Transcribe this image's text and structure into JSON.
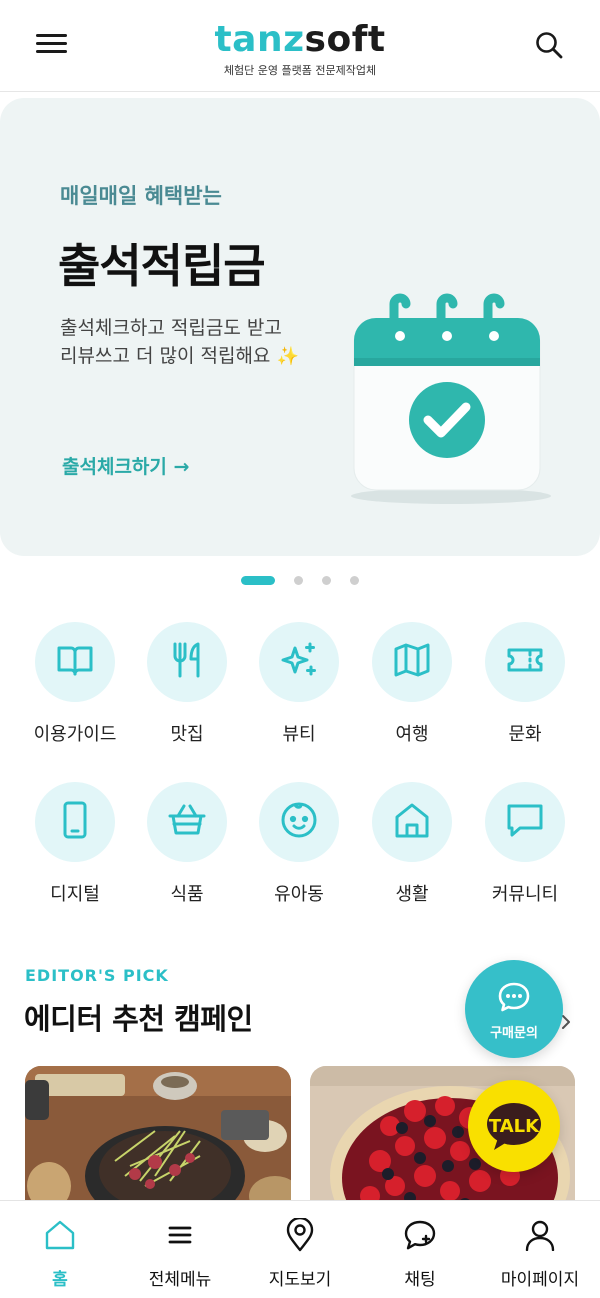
{
  "header": {
    "logo_part1": "tanz",
    "logo_part2": "soft",
    "tagline": "체험단 운영 플랫폼 전문제작업체"
  },
  "banner": {
    "eyebrow": "매일매일 혜택받는",
    "title": "출석적립금",
    "desc_line1": "출석체크하고 적립금도 받고",
    "desc_line2": "리뷰쓰고  더 많이 적립해요",
    "sparkle": "✨",
    "cta": "출석체크하기 →"
  },
  "carousel": {
    "count": 4,
    "active": 1
  },
  "categories": [
    {
      "label": "이용가이드",
      "icon": "book-icon"
    },
    {
      "label": "맛집",
      "icon": "fork-knife-icon"
    },
    {
      "label": "뷰티",
      "icon": "sparkle-icon"
    },
    {
      "label": "여행",
      "icon": "map-icon"
    },
    {
      "label": "문화",
      "icon": "ticket-icon"
    },
    {
      "label": "디지털",
      "icon": "smartphone-icon"
    },
    {
      "label": "식품",
      "icon": "basket-icon"
    },
    {
      "label": "유아동",
      "icon": "baby-face-icon"
    },
    {
      "label": "생활",
      "icon": "home-icon"
    },
    {
      "label": "커뮤니티",
      "icon": "chat-bubble-icon"
    }
  ],
  "editor_pick": {
    "eyebrow": "EDITOR'S PICK",
    "title": "에디터 추천 캠페인"
  },
  "floating": {
    "inquiry_label": "구매문의",
    "talk_label": "TALK"
  },
  "bottom_nav": [
    {
      "label": "홈",
      "icon": "home-icon"
    },
    {
      "label": "전체메뉴",
      "icon": "menu-icon"
    },
    {
      "label": "지도보기",
      "icon": "map-pin-icon"
    },
    {
      "label": "채팅",
      "icon": "chat-icon"
    },
    {
      "label": "마이페이지",
      "icon": "user-icon"
    }
  ],
  "colors": {
    "accent": "#2bbfc7",
    "banner_bg": "#eef4f4",
    "category_bg": "#e2f6f8",
    "kakao_yellow": "#f9e000"
  }
}
